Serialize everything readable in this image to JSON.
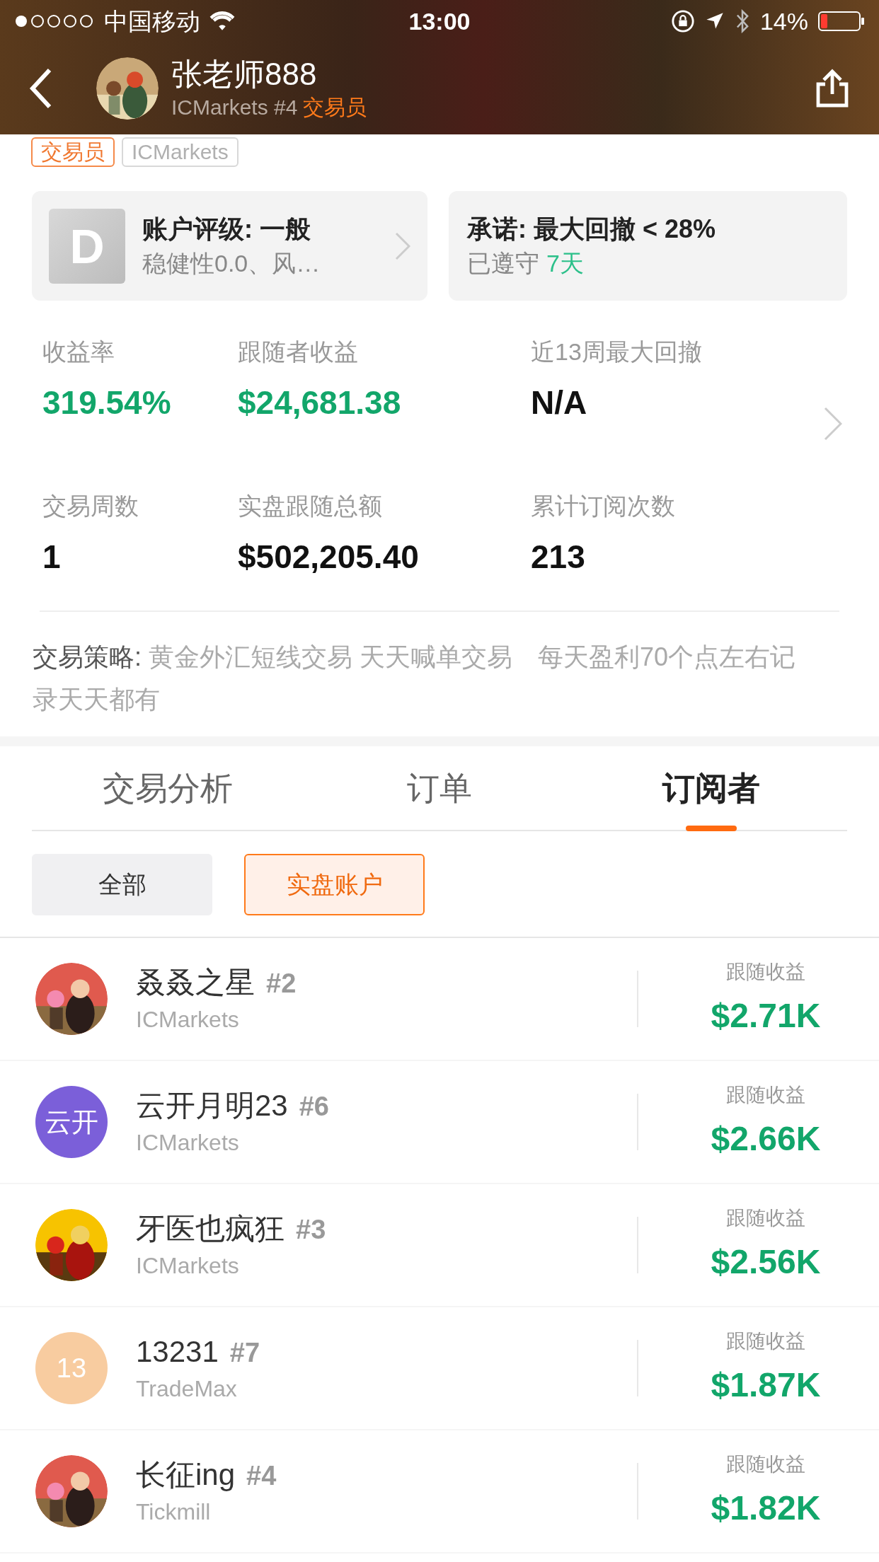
{
  "status_bar": {
    "carrier": "中国移动",
    "time": "13:00",
    "battery": "14%"
  },
  "header": {
    "name": "张老师888",
    "broker": "ICMarkets #4",
    "role": "交易员"
  },
  "tags": [
    {
      "label": "交易员",
      "kind": "accent"
    },
    {
      "label": "ICMarkets",
      "kind": "plain"
    }
  ],
  "cards": [
    {
      "kind": "rating",
      "grade": "D",
      "title": "账户评级: 一般",
      "subtitle": "稳健性0.0、风…"
    },
    {
      "kind": "promise",
      "title": "承诺: 最大回撤 < 28%",
      "subtitle": "已遵守",
      "highlight": "7天"
    }
  ],
  "stats": [
    {
      "label": "收益率",
      "value": "319.54%",
      "positive": true
    },
    {
      "label": "跟随者收益",
      "value": "$24,681.38",
      "positive": true
    },
    {
      "label": "近13周最大回撤",
      "value": "N/A",
      "positive": false
    },
    {
      "label": "交易周数",
      "value": "1",
      "positive": false
    },
    {
      "label": "实盘跟随总额",
      "value": "$502,205.40",
      "positive": false
    },
    {
      "label": "累计订阅次数",
      "value": "213",
      "positive": false
    }
  ],
  "strategy": {
    "label": "交易策略:",
    "text": "黄金外汇短线交易 天天喊单交易　每天盈利70个点左右记录天天都有"
  },
  "tabs": [
    {
      "label": "交易分析",
      "selected": false
    },
    {
      "label": "订单",
      "selected": false
    },
    {
      "label": "订阅者",
      "selected": true
    }
  ],
  "filters": [
    {
      "label": "全部",
      "selected": false
    },
    {
      "label": "实盘账户",
      "selected": true
    }
  ],
  "subscribers": [
    {
      "name": "叒叒之星",
      "rank": "#2",
      "broker": "ICMarkets",
      "profit_label": "跟随收益",
      "profit": "$2.71K"
    },
    {
      "name": "云开月明23",
      "rank": "#6",
      "broker": "ICMarkets",
      "avatar": {
        "kind": "letters",
        "text": "云开",
        "color": "#7b5fd9"
      },
      "profit_label": "跟随收益",
      "profit": "$2.66K"
    },
    {
      "name": "牙医也疯狂",
      "rank": "#3",
      "broker": "ICMarkets",
      "profit_label": "跟随收益",
      "profit": "$2.56K"
    },
    {
      "name": "13231",
      "rank": "#7",
      "broker": "TradeMax",
      "avatar": {
        "kind": "letters",
        "text": "13",
        "color": "#f8cca0"
      },
      "profit_label": "跟随收益",
      "profit": "$1.87K"
    },
    {
      "name": "长征ing",
      "rank": "#4",
      "broker": "Tickmill",
      "profit_label": "跟随收益",
      "profit": "$1.82K"
    }
  ]
}
